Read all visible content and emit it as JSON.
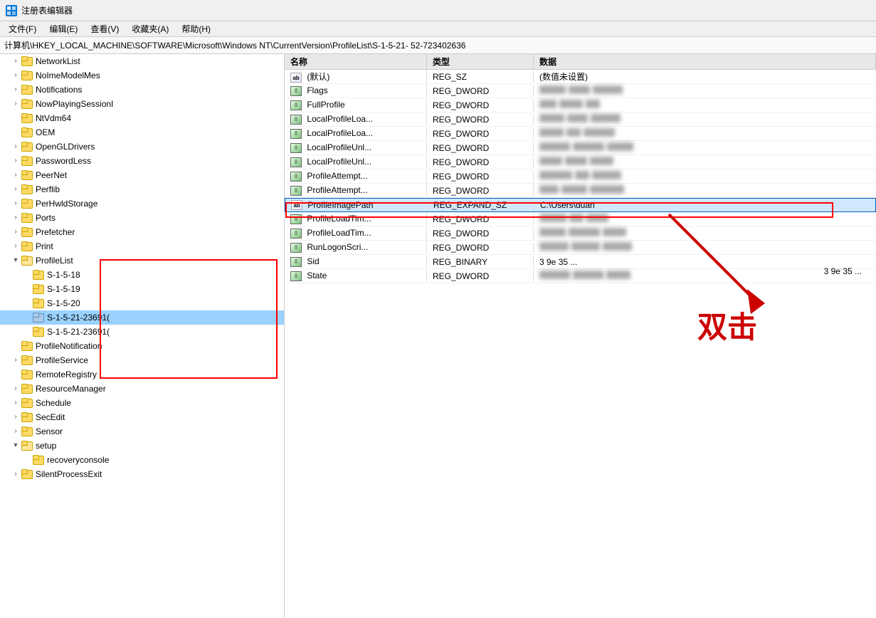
{
  "titleBar": {
    "icon": "regedit-icon",
    "title": "注册表编辑器"
  },
  "menuBar": {
    "items": [
      {
        "id": "file",
        "label": "文件(F)"
      },
      {
        "id": "edit",
        "label": "编辑(E)"
      },
      {
        "id": "view",
        "label": "查看(V)"
      },
      {
        "id": "favorites",
        "label": "收藏夹(A)"
      },
      {
        "id": "help",
        "label": "帮助(H)"
      }
    ]
  },
  "addressBar": {
    "path": "计算机\\HKEY_LOCAL_MACHINE\\SOFTWARE\\Microsoft\\Windows NT\\CurrentVersion\\ProfileList\\S-1-5-21-                   52-723402636"
  },
  "treePanel": {
    "items": [
      {
        "id": "networkList",
        "label": "NetworkList",
        "indent": 1,
        "expanded": false
      },
      {
        "id": "noImeModelMes",
        "label": "NoImeModelMes",
        "indent": 1,
        "expanded": false
      },
      {
        "id": "notifications",
        "label": "Notifications",
        "indent": 1,
        "expanded": false
      },
      {
        "id": "nowPlayingSession",
        "label": "NowPlayingSessionI",
        "indent": 1,
        "expanded": false
      },
      {
        "id": "ntVdm64",
        "label": "NtVdm64",
        "indent": 1,
        "expanded": false
      },
      {
        "id": "oem",
        "label": "OEM",
        "indent": 1,
        "expanded": false
      },
      {
        "id": "openGLDrivers",
        "label": "OpenGLDrivers",
        "indent": 1,
        "expanded": false
      },
      {
        "id": "passwordLess",
        "label": "PasswordLess",
        "indent": 1,
        "expanded": false
      },
      {
        "id": "peerNet",
        "label": "PeerNet",
        "indent": 1,
        "expanded": false
      },
      {
        "id": "perflib",
        "label": "Perflib",
        "indent": 1,
        "expanded": false
      },
      {
        "id": "perHwldStorage",
        "label": "PerHwldStorage",
        "indent": 1,
        "expanded": false
      },
      {
        "id": "ports",
        "label": "Ports",
        "indent": 1,
        "expanded": false
      },
      {
        "id": "prefetcher",
        "label": "Prefetcher",
        "indent": 1,
        "expanded": false
      },
      {
        "id": "print",
        "label": "Print",
        "indent": 1,
        "expanded": false
      },
      {
        "id": "profileList",
        "label": "ProfileList",
        "indent": 1,
        "expanded": true
      },
      {
        "id": "s-1-5-18",
        "label": "S-1-5-18",
        "indent": 2,
        "expanded": false
      },
      {
        "id": "s-1-5-19",
        "label": "S-1-5-19",
        "indent": 2,
        "expanded": false
      },
      {
        "id": "s-1-5-20",
        "label": "S-1-5-20",
        "indent": 2,
        "expanded": false
      },
      {
        "id": "s-1-5-21-1",
        "label": "S-1-5-21-23691(",
        "indent": 2,
        "expanded": false,
        "selected": true
      },
      {
        "id": "s-1-5-21-2",
        "label": "S-1-5-21-23691(",
        "indent": 2,
        "expanded": false
      },
      {
        "id": "profileNotification",
        "label": "ProfileNotification",
        "indent": 1,
        "expanded": false
      },
      {
        "id": "profileService",
        "label": "ProfileService",
        "indent": 1,
        "expanded": false
      },
      {
        "id": "remoteRegistry",
        "label": "RemoteRegistry",
        "indent": 1,
        "expanded": false
      },
      {
        "id": "resourceManager",
        "label": "ResourceManager",
        "indent": 1,
        "expanded": false
      },
      {
        "id": "schedule",
        "label": "Schedule",
        "indent": 1,
        "expanded": false
      },
      {
        "id": "secEdit",
        "label": "SecEdit",
        "indent": 1,
        "expanded": false
      },
      {
        "id": "sensor",
        "label": "Sensor",
        "indent": 1,
        "expanded": false
      },
      {
        "id": "setup",
        "label": "setup",
        "indent": 1,
        "expanded": true
      },
      {
        "id": "recoveryConsole",
        "label": "recoveryconsole",
        "indent": 2,
        "expanded": false
      },
      {
        "id": "silentProcessExit",
        "label": "SilentProcessExit",
        "indent": 1,
        "expanded": false
      }
    ]
  },
  "valuesPanel": {
    "columns": {
      "name": "名称",
      "type": "类型",
      "data": "数据"
    },
    "rows": [
      {
        "id": "default",
        "icon": "ab",
        "name": "(默认)",
        "type": "REG_SZ",
        "data": "(数值未设置)",
        "blurred": false
      },
      {
        "id": "flags",
        "icon": "bin",
        "name": "Flags",
        "type": "REG_DWORD",
        "data": "(0)",
        "blurred": true
      },
      {
        "id": "fullProfile",
        "icon": "bin",
        "name": "FullProfile",
        "type": "REG_DWORD",
        "data": "",
        "blurred": true
      },
      {
        "id": "localProfileLoa1",
        "icon": "bin",
        "name": "LocalProfileLoa...",
        "type": "REG_DWORD",
        "data": "",
        "blurred": true
      },
      {
        "id": "localProfileLoa2",
        "icon": "bin",
        "name": "LocalProfileLoa...",
        "type": "REG_DWORD",
        "data": "",
        "blurred": true
      },
      {
        "id": "localProfileUnl1",
        "icon": "bin",
        "name": "LocalProfileUnl...",
        "type": "REG_DWORD",
        "data": "",
        "blurred": true
      },
      {
        "id": "localProfileUnl2",
        "icon": "bin",
        "name": "LocalProfileUnl...",
        "type": "REG_DWORD",
        "data": "",
        "blurred": true
      },
      {
        "id": "profileAttempt1",
        "icon": "bin",
        "name": "ProfileAttempt...",
        "type": "REG_DWORD",
        "data": "",
        "blurred": true
      },
      {
        "id": "profileAttempt2",
        "icon": "bin",
        "name": "ProfileAttempt...",
        "type": "REG_DWORD",
        "data": "",
        "blurred": true
      },
      {
        "id": "profileImagePath",
        "icon": "ab",
        "name": "ProfileImagePath",
        "type": "REG_EXPAND_SZ",
        "data": "C:\\Users\\duan",
        "blurred": false,
        "highlighted": true
      },
      {
        "id": "profileLoadTim1",
        "icon": "bin",
        "name": "ProfileLoadTim...",
        "type": "REG_DWORD",
        "data": "(0)",
        "blurred": true
      },
      {
        "id": "profileLoadTim2",
        "icon": "bin",
        "name": "ProfileLoadTim...",
        "type": "REG_DWORD",
        "data": "",
        "blurred": true
      },
      {
        "id": "runLogonScr",
        "icon": "bin",
        "name": "RunLogonScri...",
        "type": "REG_DWORD",
        "data": "",
        "blurred": true
      },
      {
        "id": "sid",
        "icon": "bin",
        "name": "Sid",
        "type": "REG_BINARY",
        "data": "3 9e 35 ...",
        "blurred": false
      },
      {
        "id": "state",
        "icon": "bin",
        "name": "State",
        "type": "REG_DWORD",
        "data": "",
        "blurred": true
      }
    ]
  },
  "annotations": {
    "doubleClickText": "双击",
    "arrowColor": "#cc0000"
  }
}
